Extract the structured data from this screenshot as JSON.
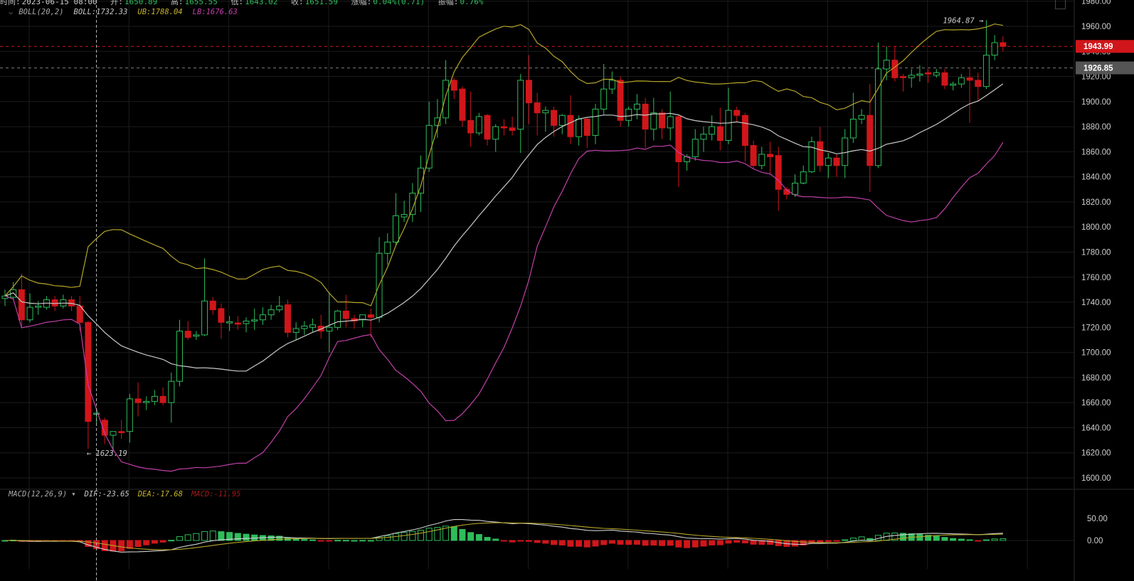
{
  "header": {
    "time_label": "时间:",
    "time": "2023-06-15 08:00",
    "open_label": "开:",
    "open": "1650.89",
    "high_label": "高:",
    "high": "1655.55",
    "low_label": "低:",
    "low": "1643.02",
    "close_label": "收:",
    "close": "1651.59",
    "change_label": "涨幅:",
    "change": "0.04%(0.71)",
    "amplitude_label": "振幅:",
    "amplitude": "0.76%"
  },
  "boll_legend": {
    "toggle": "⌵",
    "name": "BOLL(20,2)",
    "mid": "BOLL:1732.33",
    "ub": "UB:1788.04",
    "lb": "LB:1676.63"
  },
  "macd_legend": {
    "name": "MACD(12,26,9)",
    "dropdown": "▾",
    "dif": "DIF:-23.65",
    "dea": "DEA:-17.68",
    "macd": "MACD:-11.95"
  },
  "colors": {
    "up": "#2ebd5b",
    "down": "#d0161a",
    "mid": "#c8c8c8",
    "ub": "#b5a52a",
    "lb": "#c040a8",
    "dea": "#b5a52a",
    "dif": "#d0d0d0"
  },
  "chart_data": [
    {
      "type": "candlestick",
      "title": "Price with BOLL(20,2)",
      "ylim": [
        1600,
        1980
      ],
      "yticks": [
        "1980.00",
        "1960.00",
        "1940.00",
        "1920.00",
        "1900.00",
        "1880.00",
        "1860.00",
        "1840.00",
        "1820.00",
        "1800.00",
        "1780.00",
        "1760.00",
        "1740.00",
        "1720.00",
        "1700.00",
        "1680.00",
        "1660.00",
        "1640.00",
        "1620.00",
        "1600.00"
      ],
      "ohlc": [
        [
          1743,
          1750,
          1737,
          1745
        ],
        [
          1744,
          1756,
          1742,
          1750
        ],
        [
          1750,
          1763,
          1720,
          1726
        ],
        [
          1726,
          1747,
          1724,
          1736
        ],
        [
          1736,
          1741,
          1730,
          1737
        ],
        [
          1736,
          1745,
          1734,
          1742
        ],
        [
          1742,
          1745,
          1733,
          1737
        ],
        [
          1737,
          1746,
          1735,
          1742
        ],
        [
          1742,
          1745,
          1733,
          1737
        ],
        [
          1737,
          1745,
          1717,
          1724
        ],
        [
          1724,
          1725,
          1623.19,
          1645
        ],
        [
          1650.89,
          1655.55,
          1643.02,
          1651.59
        ],
        [
          1646,
          1648,
          1627,
          1634
        ],
        [
          1634,
          1637,
          1622,
          1637
        ],
        [
          1637,
          1646,
          1631,
          1636
        ],
        [
          1637,
          1667,
          1628,
          1663
        ],
        [
          1663,
          1676,
          1649,
          1660
        ],
        [
          1660,
          1665,
          1654,
          1661
        ],
        [
          1661,
          1670,
          1658,
          1665
        ],
        [
          1665,
          1672,
          1658,
          1660
        ],
        [
          1660,
          1684,
          1644,
          1677
        ],
        [
          1677,
          1726,
          1673,
          1717
        ],
        [
          1717,
          1725,
          1710,
          1712
        ],
        [
          1713,
          1717,
          1710,
          1714
        ],
        [
          1714,
          1775,
          1713,
          1741
        ],
        [
          1741,
          1744,
          1730,
          1734
        ],
        [
          1735,
          1739,
          1711,
          1724
        ],
        [
          1723.5,
          1729,
          1717,
          1724.5
        ],
        [
          1723.5,
          1729,
          1718,
          1722.5
        ],
        [
          1723,
          1728,
          1716,
          1725
        ],
        [
          1725,
          1735,
          1718,
          1726
        ],
        [
          1726,
          1736,
          1722,
          1730
        ],
        [
          1730,
          1738,
          1726,
          1734
        ],
        [
          1734,
          1745,
          1732,
          1737
        ],
        [
          1738,
          1742,
          1712,
          1716
        ],
        [
          1716,
          1724,
          1710,
          1719
        ],
        [
          1719,
          1725,
          1714,
          1721
        ],
        [
          1720,
          1727,
          1716,
          1722
        ],
        [
          1721,
          1730,
          1711,
          1717
        ],
        [
          1717,
          1748,
          1700,
          1720
        ],
        [
          1720,
          1734,
          1718,
          1733
        ],
        [
          1733,
          1746,
          1720,
          1727
        ],
        [
          1727,
          1730,
          1719,
          1725
        ],
        [
          1726,
          1730,
          1720,
          1730
        ],
        [
          1730,
          1735,
          1712,
          1728
        ],
        [
          1728,
          1792,
          1724,
          1779
        ],
        [
          1779,
          1795,
          1770,
          1788
        ],
        [
          1788,
          1827,
          1786,
          1809
        ],
        [
          1808,
          1821,
          1804,
          1810
        ],
        [
          1810,
          1835,
          1804,
          1827
        ],
        [
          1827,
          1857,
          1812,
          1847
        ],
        [
          1847,
          1900,
          1844,
          1881
        ],
        [
          1881,
          1902,
          1871,
          1887
        ],
        [
          1887,
          1933,
          1882,
          1917
        ],
        [
          1917,
          1919,
          1902,
          1909
        ],
        [
          1910,
          1912,
          1880,
          1885
        ],
        [
          1885,
          1908,
          1864,
          1875
        ],
        [
          1875,
          1891,
          1873,
          1888
        ],
        [
          1889,
          1890,
          1865,
          1870
        ],
        [
          1870,
          1882,
          1860,
          1880
        ],
        [
          1880,
          1886,
          1873,
          1879
        ],
        [
          1879,
          1888,
          1873,
          1877
        ],
        [
          1878,
          1922,
          1859,
          1917
        ],
        [
          1917,
          1937,
          1882,
          1899
        ],
        [
          1899,
          1907,
          1873,
          1891
        ],
        [
          1891,
          1896,
          1876,
          1893
        ],
        [
          1893,
          1896,
          1872,
          1881
        ],
        [
          1881,
          1890,
          1874,
          1889
        ],
        [
          1889,
          1905,
          1866,
          1872
        ],
        [
          1872,
          1889,
          1865,
          1886
        ],
        [
          1886,
          1888,
          1863,
          1873
        ],
        [
          1873,
          1898,
          1866,
          1894
        ],
        [
          1894,
          1930,
          1889,
          1910
        ],
        [
          1910,
          1924,
          1906,
          1917
        ],
        [
          1917,
          1920,
          1880,
          1885
        ],
        [
          1885,
          1896,
          1880,
          1894
        ],
        [
          1894,
          1906,
          1886,
          1898
        ],
        [
          1898,
          1903,
          1863,
          1878
        ],
        [
          1878,
          1903,
          1869,
          1891
        ],
        [
          1891,
          1894,
          1870,
          1879
        ],
        [
          1879,
          1908,
          1869,
          1888
        ],
        [
          1888,
          1890,
          1832,
          1852
        ],
        [
          1852,
          1858,
          1845,
          1856
        ],
        [
          1856,
          1878,
          1853,
          1870
        ],
        [
          1870,
          1880,
          1860,
          1874
        ],
        [
          1874,
          1889,
          1869,
          1880
        ],
        [
          1880,
          1895,
          1861,
          1869
        ],
        [
          1869,
          1911,
          1866,
          1893
        ],
        [
          1893,
          1896,
          1884,
          1889
        ],
        [
          1889,
          1891,
          1852,
          1865
        ],
        [
          1865,
          1869,
          1846,
          1849
        ],
        [
          1849,
          1864,
          1846,
          1858
        ],
        [
          1858,
          1868,
          1842,
          1856
        ],
        [
          1857,
          1864,
          1813,
          1830
        ],
        [
          1830,
          1832,
          1822,
          1826
        ],
        [
          1826,
          1842,
          1824,
          1835
        ],
        [
          1835,
          1849,
          1834,
          1844
        ],
        [
          1844,
          1872,
          1843,
          1868
        ],
        [
          1868,
          1880,
          1844,
          1849
        ],
        [
          1849,
          1859,
          1839,
          1855
        ],
        [
          1855,
          1858,
          1840,
          1849
        ],
        [
          1849,
          1878,
          1839,
          1871
        ],
        [
          1871,
          1907,
          1867,
          1886
        ],
        [
          1886,
          1894,
          1882,
          1889
        ],
        [
          1889,
          1914,
          1828,
          1849
        ],
        [
          1849,
          1947,
          1847,
          1926
        ],
        [
          1926,
          1944,
          1917,
          1933
        ],
        [
          1933,
          1944,
          1916,
          1919
        ],
        [
          1920,
          1922,
          1908,
          1919
        ],
        [
          1919,
          1926,
          1911,
          1921
        ],
        [
          1921,
          1929,
          1916,
          1922
        ],
        [
          1923,
          1926,
          1915,
          1922
        ],
        [
          1921,
          1926,
          1919,
          1923
        ],
        [
          1923,
          1926,
          1910,
          1913
        ],
        [
          1913,
          1916,
          1909,
          1914
        ],
        [
          1914,
          1922,
          1911,
          1919
        ],
        [
          1919,
          1927,
          1883,
          1917
        ],
        [
          1917,
          1923,
          1900,
          1912
        ],
        [
          1912,
          1964.87,
          1910,
          1937
        ],
        [
          1937,
          1953,
          1933,
          1947
        ],
        [
          1947,
          1952,
          1940,
          1943.99
        ]
      ],
      "crosshair_index": 11,
      "max_marker": {
        "index": 118,
        "value": 1964.87,
        "label": "1964.87 →"
      },
      "min_marker": {
        "index": 10,
        "value": 1623.19,
        "label": "← 1623.19"
      },
      "last_price": {
        "value": 1943.99,
        "label": "1943.99"
      },
      "ref_price": {
        "value": 1926.85,
        "label": "1926.85"
      }
    },
    {
      "type": "bar+line",
      "title": "MACD(12,26,9)",
      "ylim": [
        -12,
        62
      ],
      "yticks": [
        {
          "value": 50,
          "label": "50.00"
        },
        {
          "value": 0,
          "label": "0.00"
        }
      ],
      "series": [
        "DIF",
        "DEA",
        "MACD"
      ]
    }
  ]
}
